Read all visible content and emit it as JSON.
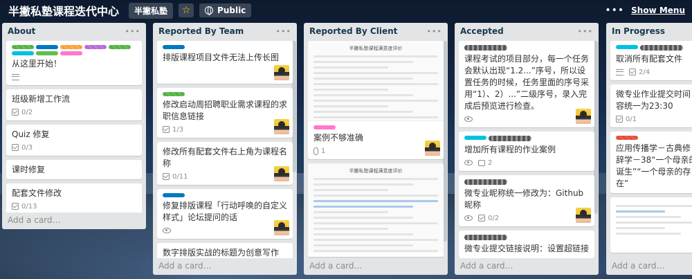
{
  "header": {
    "board_title": "半撇私塾课程迭代中心",
    "team_name": "半撇私塾",
    "visibility": "Public",
    "show_menu": "Show Menu",
    "star_icon": "star-icon",
    "globe_icon": "globe-icon"
  },
  "colors": {
    "list_bg": "#e2e4e6",
    "label_green": "#61bd4f",
    "label_blue": "#0079bf",
    "label_sky": "#00c2e0",
    "label_orange": "#ffab4a",
    "label_purple": "#c377e0",
    "label_pink": "#ff78cb",
    "label_red": "#eb5a46"
  },
  "lists": [
    {
      "title": "About",
      "add_card": "Add a card…",
      "cards": [
        {
          "title": "从这里开始！",
          "badges": {
            "description": true
          }
        },
        {
          "title": "班级新增工作流",
          "checklist": "0/2"
        },
        {
          "title": "Quiz 修复",
          "checklist": "0/3"
        },
        {
          "title": "课时修复"
        },
        {
          "title": "配套文件修改",
          "checklist": "0/13"
        }
      ]
    },
    {
      "title": "Reported By Team",
      "add_card": "Add a card…",
      "cards": [
        {
          "title": "排版课程项目文件无法上传长图"
        },
        {
          "title": "修改启动周招聘职业需求课程的求职信息链接",
          "checklist": "1/3"
        },
        {
          "title": "修改所有配套文件右上角为课程名称",
          "checklist": "0/11"
        },
        {
          "title": "修复排版课程「行动呼唤的自定义样式」论坛提问的话"
        },
        {
          "title": "数字排版实战的标题为创意写作"
        }
      ]
    },
    {
      "title": "Reported By Client",
      "add_card": "Add a card…",
      "cards": [
        {
          "thumb_title": "半撇私塾课程满意度评价",
          "title": "案例不够准确",
          "attachments": "1"
        },
        {
          "thumb_title": "半撇私塾课程满意度评价"
        }
      ]
    },
    {
      "title": "Accepted",
      "add_card": "Add a card…",
      "cards": [
        {
          "title": "课程考试的项目部分，每一个任务会默认出现“1.2...”序号，所以设置任务的时候，任务里面的序号采用“1）、2）...”二级序号，录入完成后预览进行检查。"
        },
        {
          "title": "增加所有课程的作业案例",
          "comments": "2"
        },
        {
          "title": "微专业昵称统一修改为：Github昵称",
          "checklist": "0/2"
        },
        {
          "title": "微专业提交链接说明：设置超链接"
        }
      ]
    },
    {
      "title": "In Progress",
      "add_card": "Add a card…",
      "cards": [
        {
          "title": "取消所有配套文件",
          "checklist": "2/4"
        },
        {
          "title": "微专业作业提交时间容统一为23:30",
          "checklist": "0/1"
        },
        {
          "title": "应用传播学－古典修辞学－38“一个母亲的诞生”“一个母亲的存在”"
        }
      ]
    }
  ]
}
